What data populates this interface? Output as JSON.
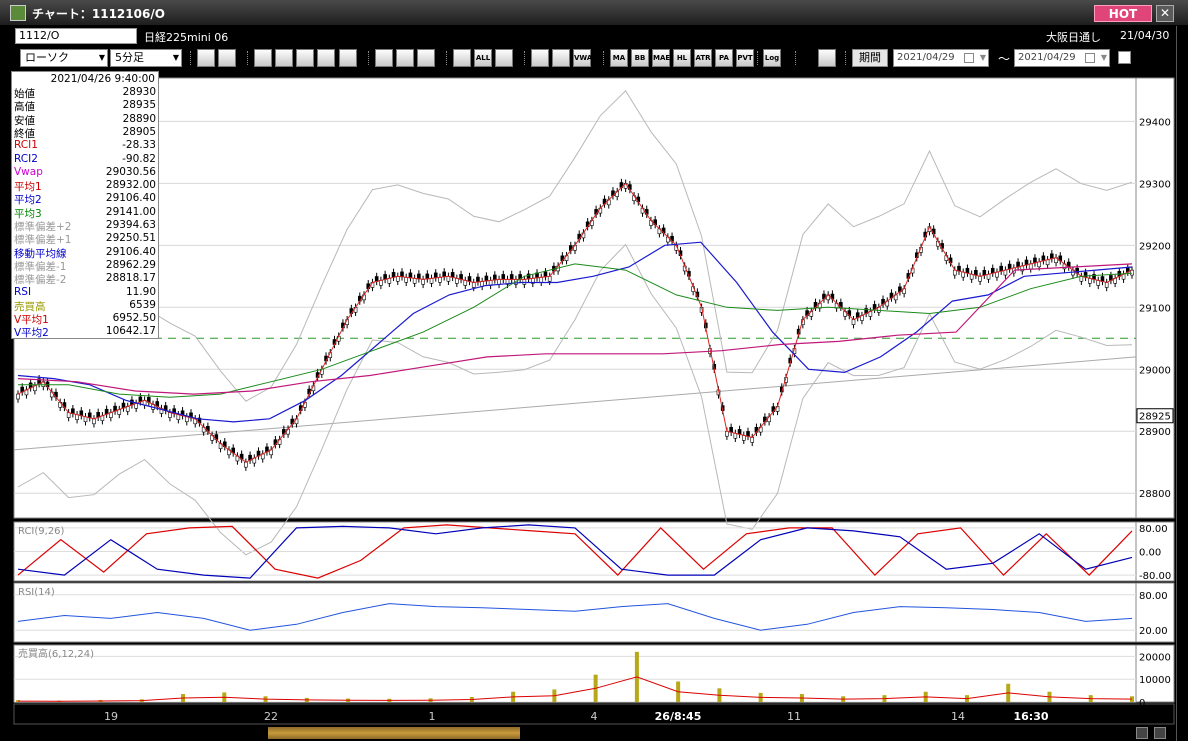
{
  "window": {
    "title": "チャート：1112106/O",
    "hot_label": "HOT",
    "close_label": "✕",
    "icon": "chart-app-icon"
  },
  "symbol_bar": {
    "symbol_value": "1112/O",
    "symbol_name": "日経225mini 06",
    "session_label": "大阪日通し",
    "session_date": "21/04/30"
  },
  "toolbar": {
    "chart_type": "ローソク",
    "interval": "5分足",
    "period_label": "期間",
    "date_from": "2021/04/29",
    "date_to": "2021/04/29",
    "tilde": "～",
    "buttons": [
      {
        "name": "zoom-icon",
        "text": ""
      },
      {
        "name": "crosshair-icon",
        "text": ""
      },
      {
        "name": "arrow-down-icon",
        "text": ""
      },
      {
        "name": "zoom-fit-icon",
        "text": ""
      },
      {
        "name": "cross-cursor-icon",
        "text": ""
      },
      {
        "name": "line-tool-icon",
        "text": ""
      },
      {
        "name": "pencil-icon",
        "text": ""
      },
      {
        "name": "select-cursor-icon",
        "text": ""
      },
      {
        "name": "undo-icon",
        "text": ""
      },
      {
        "name": "candle-left-icon",
        "text": ""
      },
      {
        "name": "candle-right-icon",
        "text": ""
      },
      {
        "name": "all-button",
        "text": "ALL"
      },
      {
        "name": "settings-icon",
        "text": ""
      },
      {
        "name": "tools-icon",
        "text": ""
      },
      {
        "name": "color-icon",
        "text": ""
      },
      {
        "name": "vwap-button",
        "text": "VWAP"
      },
      {
        "name": "ma-button",
        "text": "MA"
      },
      {
        "name": "bb-button",
        "text": "BB"
      },
      {
        "name": "mae-button",
        "text": "MAE"
      },
      {
        "name": "hl-button",
        "text": "HL"
      },
      {
        "name": "atr-button",
        "text": "ATR"
      },
      {
        "name": "para-button",
        "text": "PA RA"
      },
      {
        "name": "pvt-button",
        "text": "PVT"
      },
      {
        "name": "log-button",
        "text": "Log"
      },
      {
        "name": "export-icon",
        "text": ""
      }
    ]
  },
  "info_panel": {
    "datetime": "2021/04/26 9:40:00",
    "rows": [
      {
        "label": "始値",
        "value": "28930",
        "color": "#000000"
      },
      {
        "label": "高値",
        "value": "28935",
        "color": "#000000"
      },
      {
        "label": "安値",
        "value": "28890",
        "color": "#000000"
      },
      {
        "label": "終値",
        "value": "28905",
        "color": "#000000"
      },
      {
        "label": "RCI1",
        "value": "-28.33",
        "color": "#cc0000"
      },
      {
        "label": "RCI2",
        "value": "-90.82",
        "color": "#0000cc"
      },
      {
        "label": "Vwap",
        "value": "29030.56",
        "color": "#cc00cc"
      },
      {
        "label": "平均1",
        "value": "28932.00",
        "color": "#cc0000"
      },
      {
        "label": "平均2",
        "value": "29106.40",
        "color": "#0000cc"
      },
      {
        "label": "平均3",
        "value": "29141.00",
        "color": "#008800"
      },
      {
        "label": "標準偏差+2",
        "value": "29394.63",
        "color": "#999999"
      },
      {
        "label": "標準偏差+1",
        "value": "29250.51",
        "color": "#999999"
      },
      {
        "label": "移動平均線",
        "value": "29106.40",
        "color": "#0000cc"
      },
      {
        "label": "標準偏差-1",
        "value": "28962.29",
        "color": "#999999"
      },
      {
        "label": "標準偏差-2",
        "value": "28818.17",
        "color": "#999999"
      },
      {
        "label": "RSI",
        "value": "11.90",
        "color": "#0000cc"
      },
      {
        "label": "売買高",
        "value": "6539",
        "color": "#999900"
      },
      {
        "label": "V平均1",
        "value": "6952.50",
        "color": "#cc0000"
      },
      {
        "label": "V平均2",
        "value": "10642.17",
        "color": "#0000cc"
      }
    ]
  },
  "chart_data": {
    "type": "candlestick",
    "price_panel": {
      "ylim": [
        28760,
        29470
      ],
      "yticks": [
        "29400",
        "29300",
        "29200",
        "29100",
        "29000",
        "28900",
        "28800"
      ],
      "current_price_label": "28925",
      "reference_line_value": 29050,
      "price_path": [
        28960,
        28980,
        28930,
        28920,
        28935,
        28950,
        28930,
        28920,
        28880,
        28850,
        28870,
        28920,
        29000,
        29080,
        29140,
        29150,
        29145,
        29150,
        29140,
        29145,
        29145,
        29150,
        29200,
        29260,
        29300,
        29240,
        29200,
        29100,
        28900,
        28890,
        28940,
        29080,
        29120,
        29080,
        29100,
        29130,
        29230,
        29160,
        29150,
        29160,
        29170,
        29180,
        29150,
        29140,
        29160
      ],
      "ma_blue": [
        28990,
        28985,
        28975,
        28950,
        28935,
        28920,
        28915,
        28920,
        28950,
        28990,
        29040,
        29090,
        29120,
        29135,
        29140,
        29140,
        29150,
        29165,
        29200,
        29205,
        29140,
        29060,
        29000,
        28995,
        29020,
        29060,
        29110,
        29120,
        29150,
        29155,
        29160,
        29165
      ],
      "ma_green": [
        28975,
        28975,
        28960,
        28955,
        28960,
        28980,
        29000,
        29030,
        29060,
        29100,
        29150,
        29170,
        29160,
        29120,
        29100,
        29095,
        29100,
        29095,
        29090,
        29100,
        29130,
        29150,
        29155
      ],
      "vwap_magenta": [
        28985,
        28980,
        28965,
        28960,
        28965,
        28980,
        28990,
        29005,
        29020,
        29025,
        29025,
        29025,
        29030,
        29040,
        29045,
        29055,
        29060,
        29160,
        29165,
        29170
      ],
      "trend_line": [
        28870,
        29020
      ]
    },
    "rci_panel": {
      "label": "RCI(9,26)",
      "ylim": [
        -100,
        100
      ],
      "yticks": [
        "80.00",
        "0.00",
        "-80.00"
      ],
      "rci_fast": [
        -80,
        40,
        -70,
        60,
        80,
        85,
        -60,
        -90,
        -30,
        80,
        90,
        80,
        70,
        60,
        -80,
        80,
        -60,
        60,
        80,
        80,
        -80,
        60,
        80,
        -80,
        60,
        -80,
        70
      ],
      "rci_slow": [
        -60,
        -80,
        40,
        -60,
        -80,
        -90,
        80,
        85,
        80,
        60,
        80,
        90,
        80,
        -60,
        -80,
        -80,
        40,
        80,
        70,
        50,
        -60,
        -40,
        60,
        -60,
        -20
      ]
    },
    "rsi_panel": {
      "label": "RSI(14)",
      "ylim": [
        0,
        100
      ],
      "yticks": [
        "80.00",
        "20.00"
      ],
      "rsi": [
        35,
        45,
        40,
        50,
        40,
        20,
        30,
        50,
        65,
        60,
        58,
        55,
        52,
        60,
        65,
        40,
        20,
        30,
        50,
        60,
        58,
        55,
        50,
        35,
        40
      ]
    },
    "volume_panel": {
      "label": "売買高(6,12,24)",
      "ylim": [
        0,
        25000
      ],
      "yticks": [
        "20000",
        "10000",
        "0"
      ],
      "volume": [
        800,
        600,
        900,
        1200,
        3500,
        4200,
        2500,
        1800,
        1500,
        1400,
        1600,
        2200,
        4500,
        5500,
        12000,
        22000,
        9000,
        6000,
        4000,
        3500,
        2500,
        3000,
        4500,
        3000,
        8000,
        4500,
        3000,
        2500
      ]
    },
    "x_ticks": [
      "19",
      "22",
      "1",
      "4",
      "26/8:45",
      "11",
      "14",
      "16:30"
    ]
  }
}
